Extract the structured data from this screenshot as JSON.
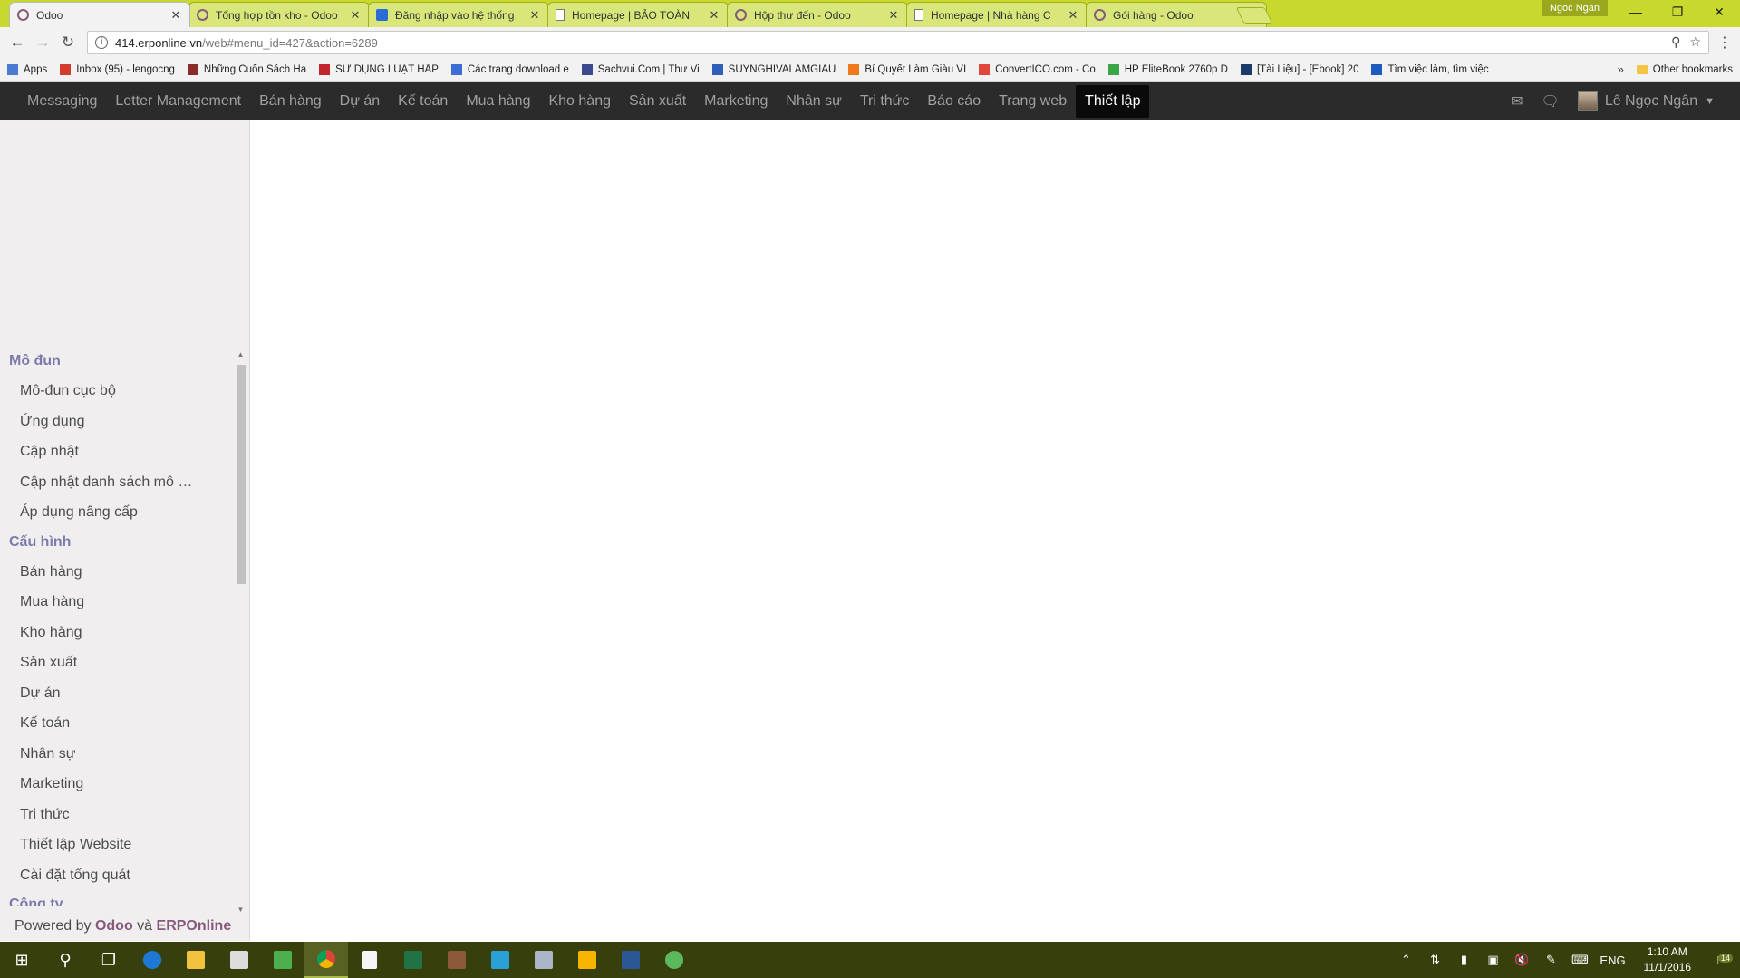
{
  "browser": {
    "tabs": [
      {
        "title": "Odoo",
        "icon": "odoo-ring-icon",
        "active": true
      },
      {
        "title": "Tổng hợp tồn kho - Odoo",
        "icon": "odoo-ring-icon",
        "active": false
      },
      {
        "title": "Đăng nhập vào hệ thống",
        "icon": "site-icon",
        "active": false
      },
      {
        "title": "Homepage | BẢO TOÀN",
        "icon": "page-icon",
        "active": false
      },
      {
        "title": "Hộp thư đến - Odoo",
        "icon": "odoo-ring-icon",
        "active": false
      },
      {
        "title": "Homepage | Nhà hàng C",
        "icon": "page-icon",
        "active": false
      },
      {
        "title": "Gói hàng - Odoo",
        "icon": "odoo-ring-icon",
        "active": false
      }
    ],
    "profile": "Ngoc Ngan",
    "url_host": "414.erponline.vn",
    "url_path": "/web#menu_id=427&action=6289",
    "bookmarks": [
      {
        "label": "Apps",
        "color": "#4a7bd0"
      },
      {
        "label": "Inbox (95) - lengocng",
        "color": "#d33b2c"
      },
      {
        "label": "Những Cuốn Sách Ha",
        "color": "#8b2c2c"
      },
      {
        "label": "SỬ DỤNG LUẬT HẤP",
        "color": "#c0262c"
      },
      {
        "label": "Các trang download e",
        "color": "#3c6fd6"
      },
      {
        "label": "Sachvui.Com | Thư Vi",
        "color": "#3b4a8c"
      },
      {
        "label": "SUYNGHIVALAMGIAU",
        "color": "#2f5fb8"
      },
      {
        "label": "Bí Quyết Làm Giàu VI",
        "color": "#f07a1a"
      },
      {
        "label": "ConvertICO.com - Co",
        "color": "#e0463b"
      },
      {
        "label": "HP EliteBook 2760p D",
        "color": "#3aa648"
      },
      {
        "label": "[Tài Liệu] - [Ebook] 20",
        "color": "#1b3c6b"
      },
      {
        "label": "Tìm việc làm, tìm việc",
        "color": "#1d5bbf"
      }
    ],
    "bookmarks_more": "»",
    "other_bookmarks": "Other bookmarks"
  },
  "odoo": {
    "menu": [
      "Messaging",
      "Letter Management",
      "Bán hàng",
      "Dự án",
      "Kế toán",
      "Mua hàng",
      "Kho hàng",
      "Sản xuất",
      "Marketing",
      "Nhân sự",
      "Tri thức",
      "Báo cáo",
      "Trang web",
      "Thiết lập"
    ],
    "active_menu": "Thiết lập",
    "user_name": "Lê Ngọc Ngân",
    "sidebar": {
      "sections": [
        {
          "title": "Mô đun",
          "items": [
            "Mô-đun cục bộ",
            "Ứng dụng",
            "Cập nhật",
            "Cập nhật danh sách mô …",
            "Áp dụng nâng cấp"
          ]
        },
        {
          "title": "Cấu hình",
          "items": [
            "Bán hàng",
            "Mua hàng",
            "Kho hàng",
            "Sản xuất",
            "Dự án",
            "Kế toán",
            "Nhân sự",
            "Marketing",
            "Tri thức",
            "Thiết lập Website",
            "Cài đặt tổng quát"
          ]
        },
        {
          "title": "Công ty",
          "items": []
        }
      ]
    },
    "powered": {
      "prefix": "Powered by",
      "odoo": "Odoo",
      "and": "và",
      "erp": "ERPOnline"
    }
  },
  "taskbar": {
    "lang": "ENG",
    "time": "1:10 AM",
    "date": "11/1/2016",
    "notifications": "14"
  },
  "colors": {
    "odoo_purple": "#875a7b",
    "nav_bg": "#2b2b2b",
    "tab_strip": "#c8d82c",
    "section_title": "#7c7bad"
  }
}
